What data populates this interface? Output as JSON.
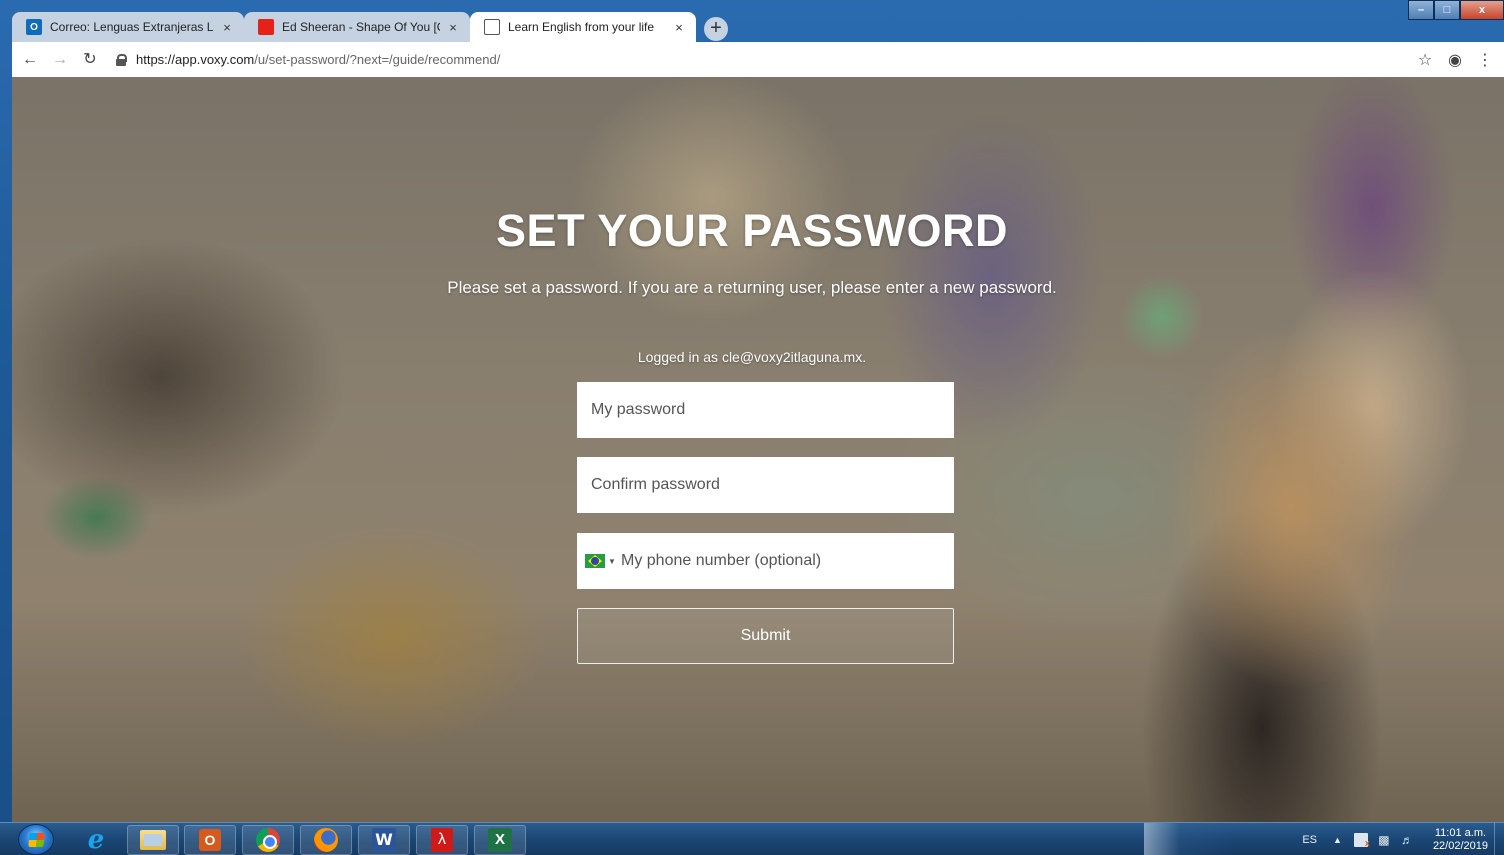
{
  "browser": {
    "tabs": [
      {
        "title": "Correo: Lenguas Extranjeras La La",
        "favicon": "outlook-icon",
        "active": false
      },
      {
        "title": "Ed Sheeran - Shape Of You [Offic",
        "favicon": "youtube-icon",
        "active": false
      },
      {
        "title": "Learn English from your life",
        "favicon": "document-icon",
        "active": true
      }
    ],
    "new_tab_label": "+",
    "close_glyph": "×",
    "url_host": "https://app.voxy.com",
    "url_path": "/u/set-password/?next=/guide/recommend/",
    "outlook_favicon_text": "O"
  },
  "page": {
    "title": "SET YOUR PASSWORD",
    "subtitle": "Please set a password. If you are a returning user, please enter a new password.",
    "logged_in": "Logged in as cle@voxy2itlaguna.mx.",
    "password_placeholder": "My password",
    "confirm_placeholder": "Confirm password",
    "phone_placeholder": "My phone number (optional)",
    "phone_country": "BR",
    "submit_label": "Submit"
  },
  "taskbar": {
    "apps": [
      "internet-explorer",
      "file-explorer",
      "outlook",
      "chrome",
      "firefox",
      "word",
      "acrobat",
      "excel"
    ],
    "word_label": "W",
    "excel_label": "X",
    "outlook_label": "O",
    "ie_label": "e",
    "language": "ES",
    "time": "11:01 a.m.",
    "date": "22/02/2019"
  },
  "colors": {
    "titlebar": "#1f5a98",
    "taskbar": "#1b4775",
    "button_border": "#ffffff"
  }
}
